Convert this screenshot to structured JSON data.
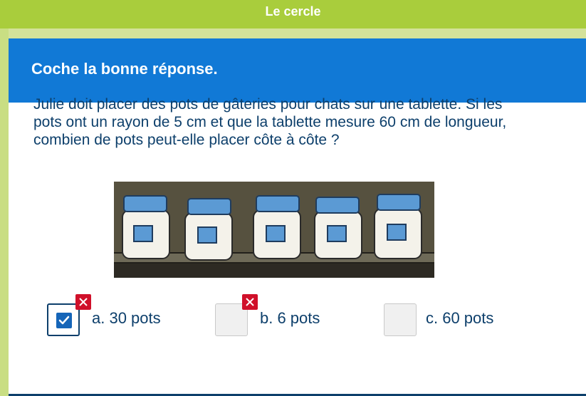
{
  "header": {
    "title": "Le cercle"
  },
  "card": {
    "instruction": "Coche la bonne réponse."
  },
  "question": {
    "text": "Julie doit placer des pots de gâteries pour chats sur une tablette. Si les pots ont un rayon de 5 cm et que la tablette mesure 60 cm de longueur, combien de pots peut-elle placer côte à côte ?"
  },
  "image": {
    "subject": "jars-on-shelf"
  },
  "options": [
    {
      "label": "a. 30 pots",
      "checked": true,
      "marked_wrong": true
    },
    {
      "label": "b. 6 pots",
      "checked": false,
      "marked_wrong": true
    },
    {
      "label": "c. 60 pots",
      "checked": false,
      "marked_wrong": false
    }
  ],
  "colors": {
    "topbar": "#a9cd3c",
    "header": "#1179d6",
    "text": "#0d3f6b",
    "wrong": "#d0102a"
  }
}
